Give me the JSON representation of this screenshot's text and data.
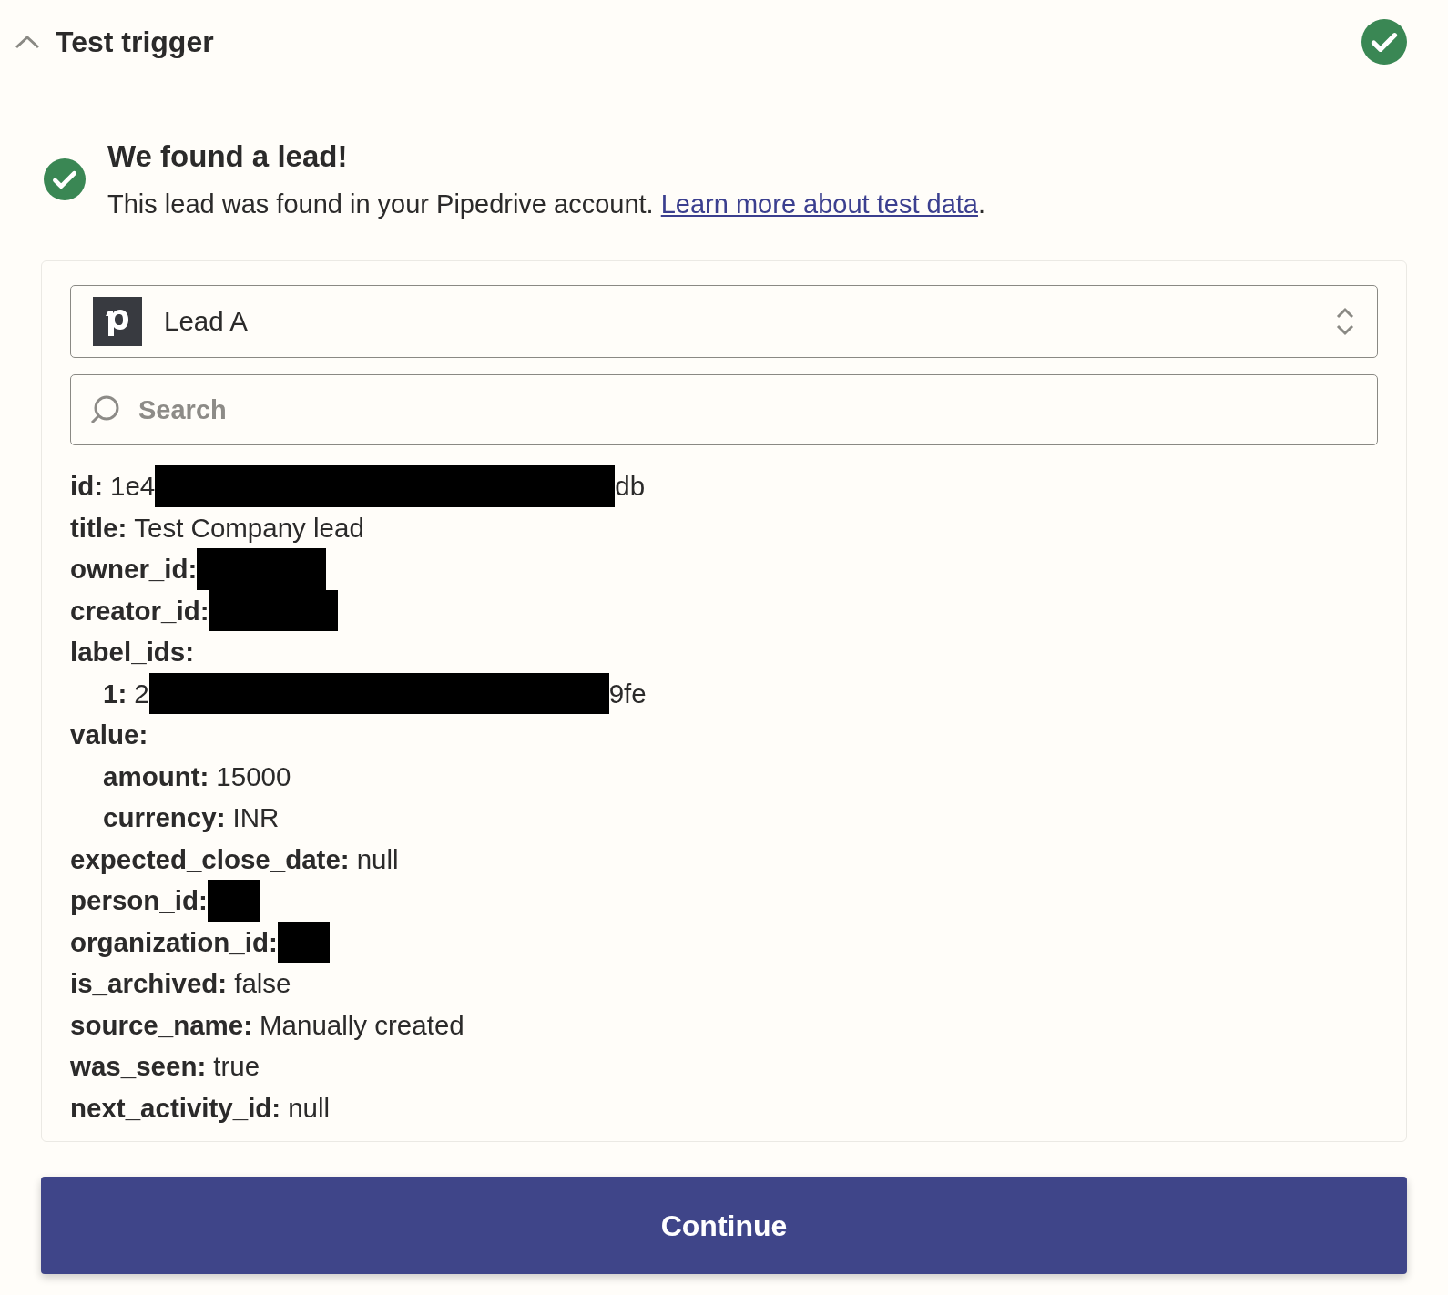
{
  "section": {
    "title": "Test trigger",
    "expanded": true,
    "complete": true
  },
  "result": {
    "heading": "We found a lead!",
    "message": "This lead was found in your Pipedrive account.",
    "link": "Learn more about test data",
    "after_link": "."
  },
  "record_select": {
    "value": "Lead A"
  },
  "search": {
    "placeholder": "Search"
  },
  "fields": [
    {
      "key": "id:",
      "value": "1e4",
      "redacted": true,
      "kind": "long",
      "value_end": "db"
    },
    {
      "key": "title:",
      "value": "Test Company lead"
    },
    {
      "key": "owner_id:",
      "redacted": true,
      "kind": "medium"
    },
    {
      "key": "creator_id:",
      "redacted": true,
      "kind": "medium"
    },
    {
      "key": "label_ids:",
      "children": [
        {
          "key": "1:",
          "value": "2",
          "redacted": true,
          "kind": "long",
          "value_end": "9fe"
        }
      ]
    },
    {
      "key": "value:",
      "children": [
        {
          "key": "amount:",
          "value": "15000"
        },
        {
          "key": "currency:",
          "value": "INR"
        }
      ]
    },
    {
      "key": "expected_close_date:",
      "value": "null"
    },
    {
      "key": "person_id:",
      "redacted": true,
      "kind": "short"
    },
    {
      "key": "organization_id:",
      "redacted": true,
      "kind": "short"
    },
    {
      "key": "is_archived:",
      "value": "false"
    },
    {
      "key": "source_name:",
      "value": "Manually created"
    },
    {
      "key": "was_seen:",
      "value": "true"
    },
    {
      "key": "next_activity_id:",
      "value": "null"
    }
  ],
  "continue_button": "Continue"
}
